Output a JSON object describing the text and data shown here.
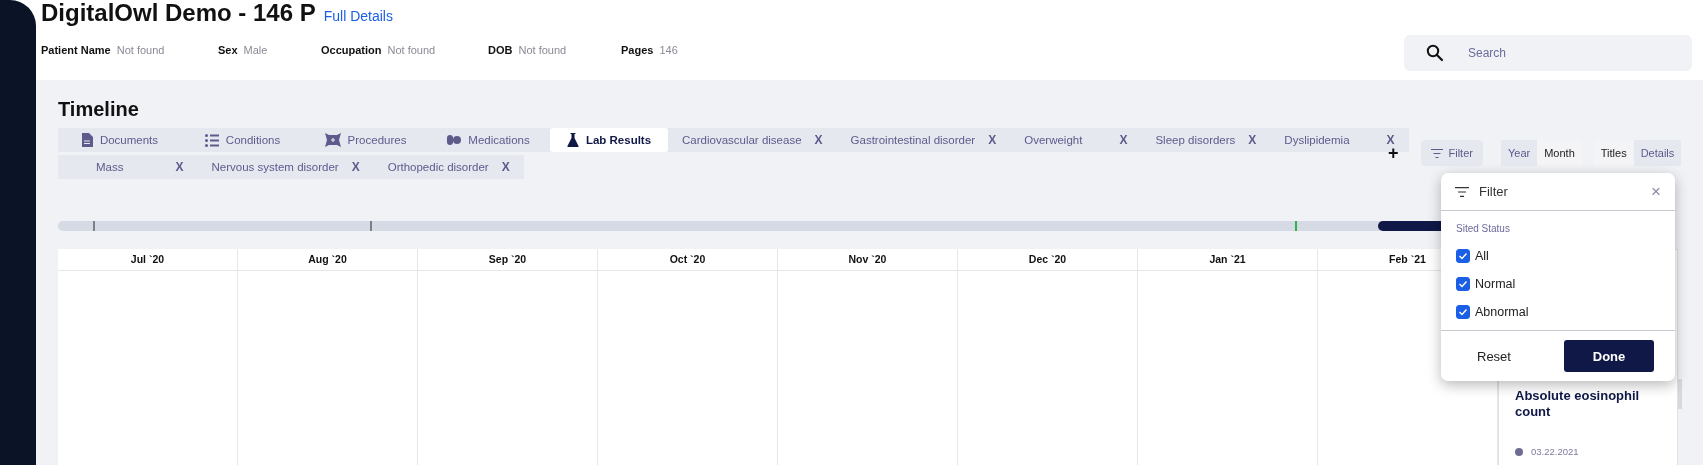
{
  "header": {
    "title": "DigitalOwl Demo - 146 P",
    "details_link": "Full Details",
    "fields": [
      {
        "label": "Patient Name",
        "value": "Not found"
      },
      {
        "label": "Sex",
        "value": "Male"
      },
      {
        "label": "Occupation",
        "value": "Not found"
      },
      {
        "label": "DOB",
        "value": "Not found"
      },
      {
        "label": "Pages",
        "value": "146"
      }
    ],
    "search": {
      "placeholder": "Search"
    }
  },
  "timeline": {
    "title": "Timeline",
    "tab_rows": [
      [
        {
          "label": "Documents",
          "kind": "category",
          "selected": false
        },
        {
          "label": "Conditions",
          "kind": "category",
          "selected": false
        },
        {
          "label": "Procedures",
          "kind": "category",
          "selected": false
        },
        {
          "label": "Medications",
          "kind": "category",
          "selected": false
        },
        {
          "label": "Lab Results",
          "kind": "category",
          "selected": true
        },
        {
          "label": "Cardiovascular disease",
          "kind": "condition",
          "remove": "X",
          "selected": false
        },
        {
          "label": "Gastrointestinal disorder",
          "kind": "condition",
          "remove": "X",
          "selected": false
        },
        {
          "label": "Overweight",
          "kind": "condition",
          "remove": "X",
          "selected": false
        },
        {
          "label": "Sleep disorders",
          "kind": "condition",
          "remove": "X",
          "selected": false
        },
        {
          "label": "Dyslipidemia",
          "kind": "condition",
          "remove": "X",
          "selected": false
        }
      ],
      [
        {
          "label": "Mass",
          "kind": "condition",
          "remove": "X",
          "selected": false
        },
        {
          "label": "Nervous system disorder",
          "kind": "condition",
          "remove": "X",
          "selected": false
        },
        {
          "label": "Orthopedic disorder",
          "kind": "condition",
          "remove": "X",
          "selected": false
        }
      ]
    ],
    "add_button": "+",
    "filter_button": "Filter",
    "scale_toggle": [
      {
        "label": "Year",
        "selected": false
      },
      {
        "label": "Month",
        "selected": true
      }
    ],
    "view_toggle": [
      {
        "label": "Titles",
        "selected": true
      },
      {
        "label": "Details",
        "selected": false
      }
    ],
    "months": [
      "Jul `20",
      "Aug `20",
      "Sep `20",
      "Oct `20",
      "Nov `20",
      "Dec `20",
      "Jan `21",
      "Feb `21"
    ],
    "card": {
      "title": "Absolute eosinophil count",
      "date": "03.22.2021"
    }
  },
  "filter_popup": {
    "title": "Filter",
    "close": "×",
    "section": "Sited Status",
    "options": [
      {
        "label": "All",
        "checked": true
      },
      {
        "label": "Normal",
        "checked": true
      },
      {
        "label": "Abnormal",
        "checked": true
      }
    ],
    "reset_button": "Reset",
    "done_button": "Done"
  }
}
